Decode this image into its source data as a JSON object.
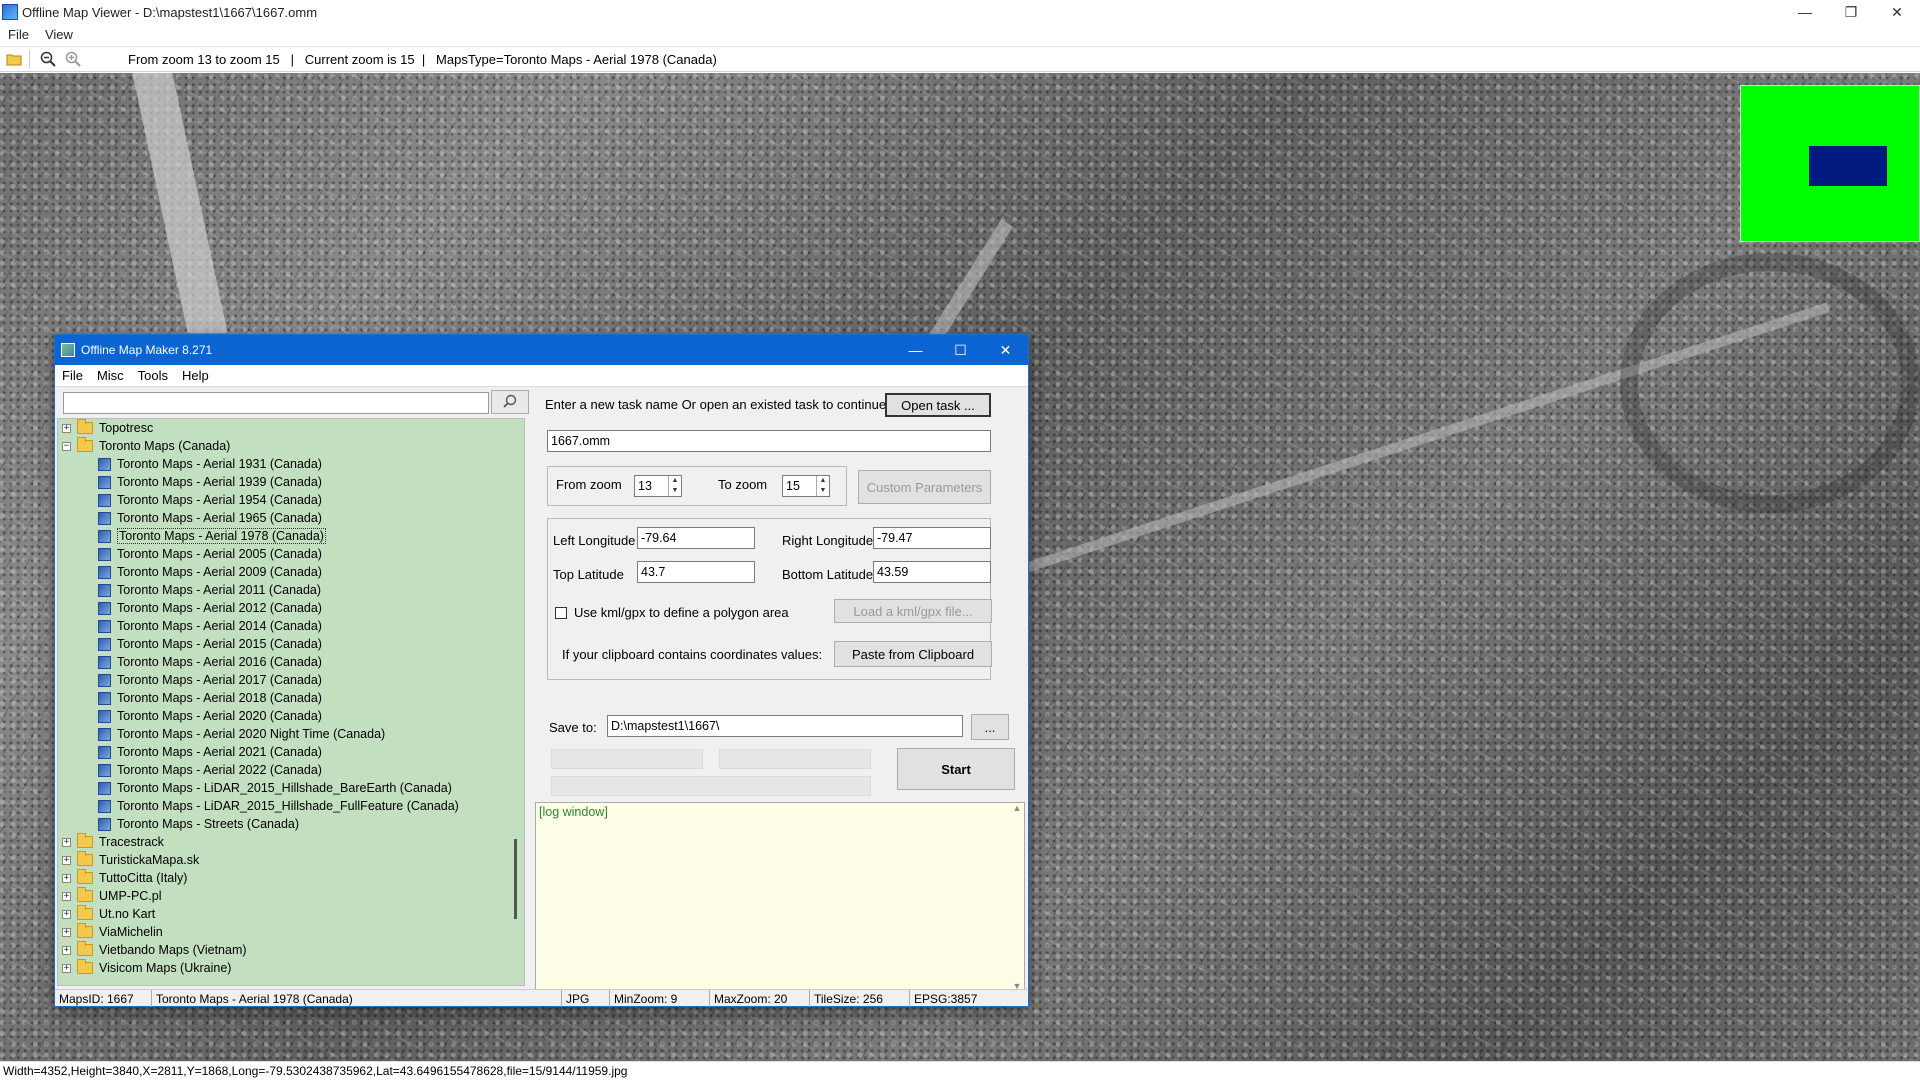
{
  "window": {
    "title": "Offline Map Viewer - D:\\mapstest1\\1667\\1667.omm",
    "controls": {
      "minimize": "—",
      "restore": "❐",
      "close": "✕"
    }
  },
  "menubar": {
    "file": "File",
    "view": "View"
  },
  "toolbar": {
    "status_text": "From zoom 13 to zoom 15   |   Current zoom is 15  |   MapsType=Toronto Maps - Aerial 1978 (Canada)"
  },
  "map": {
    "minimap_colors": {
      "background": "#00ff00",
      "viewport": "#001a80"
    }
  },
  "statusbar": {
    "text": "Width=4352,Height=3840,X=2811,Y=1868,Long=-79.5302438735962,Lat=43.6496155478628,file=15/9144/11959.jpg"
  },
  "dialog": {
    "title": "Offline Map Maker 8.271",
    "controls": {
      "minimize": "—",
      "maximize": "☐",
      "close": "✕"
    },
    "menu": {
      "file": "File",
      "misc": "Misc",
      "tools": "Tools",
      "help": "Help"
    },
    "search": {
      "value": ""
    },
    "tree": {
      "top_folders": [
        {
          "label": "Topotresc",
          "expander": "+"
        },
        {
          "label": "Toronto Maps (Canada)",
          "expander": "−"
        }
      ],
      "children": [
        "Toronto Maps - Aerial 1931 (Canada)",
        "Toronto Maps - Aerial 1939 (Canada)",
        "Toronto Maps - Aerial 1954 (Canada)",
        "Toronto Maps - Aerial 1965 (Canada)",
        "Toronto Maps - Aerial 1978 (Canada)",
        "Toronto Maps - Aerial 2005 (Canada)",
        "Toronto Maps - Aerial 2009 (Canada)",
        "Toronto Maps - Aerial 2011 (Canada)",
        "Toronto Maps - Aerial 2012 (Canada)",
        "Toronto Maps - Aerial 2014 (Canada)",
        "Toronto Maps - Aerial 2015 (Canada)",
        "Toronto Maps - Aerial 2016 (Canada)",
        "Toronto Maps - Aerial 2017 (Canada)",
        "Toronto Maps - Aerial 2018 (Canada)",
        "Toronto Maps - Aerial 2020 (Canada)",
        "Toronto Maps - Aerial 2020 Night Time (Canada)",
        "Toronto Maps - Aerial 2021 (Canada)",
        "Toronto Maps - Aerial 2022 (Canada)",
        "Toronto Maps - LiDAR_2015_Hillshade_BareEarth (Canada)",
        "Toronto Maps - LiDAR_2015_Hillshade_FullFeature (Canada)",
        "Toronto Maps - Streets (Canada)"
      ],
      "bottom_folders": [
        "Tracestrack",
        "TuristickaMapa.sk",
        "TuttoCitta (Italy)",
        "UMP-PC.pl",
        "Ut.no Kart",
        "ViaMichelin",
        "Vietbando Maps (Vietnam)",
        "Visicom Maps (Ukraine)"
      ],
      "selected": "Toronto Maps - Aerial 1978 (Canada)"
    },
    "task": {
      "prompt": "Enter a new task name Or open an existed task to continue:",
      "open_button": "Open task ...",
      "name_value": "1667.omm"
    },
    "zoom": {
      "from_label": "From zoom",
      "from_value": "13",
      "to_label": "To zoom",
      "to_value": "15",
      "custom_button": "Custom Parameters"
    },
    "area": {
      "left_lon_label": "Left Longitude",
      "left_lon_value": "-79.64",
      "right_lon_label": "Right Longitude",
      "right_lon_value": "-79.47",
      "top_lat_label": "Top Latitude",
      "top_lat_value": "43.7",
      "bottom_lat_label": "Bottom Latitude",
      "bottom_lat_value": "43.59",
      "kml_checkbox_label": "Use kml/gpx to define a polygon area",
      "kml_button": "Load a kml/gpx file...",
      "clipboard_label": "If your clipboard contains coordinates values:",
      "clipboard_button": "Paste from Clipboard"
    },
    "save": {
      "label": "Save to:",
      "value": "D:\\mapstest1\\1667\\",
      "browse_button": "...",
      "start_button": "Start"
    },
    "log": {
      "text": "[log window]"
    },
    "status": {
      "maps_id": "MapsID: 1667",
      "map_name": "Toronto Maps - Aerial 1978 (Canada)",
      "format": "JPG",
      "min_zoom": "MinZoom: 9",
      "max_zoom": "MaxZoom: 20",
      "tile_size": "TileSize: 256",
      "epsg": "EPSG:3857"
    }
  }
}
